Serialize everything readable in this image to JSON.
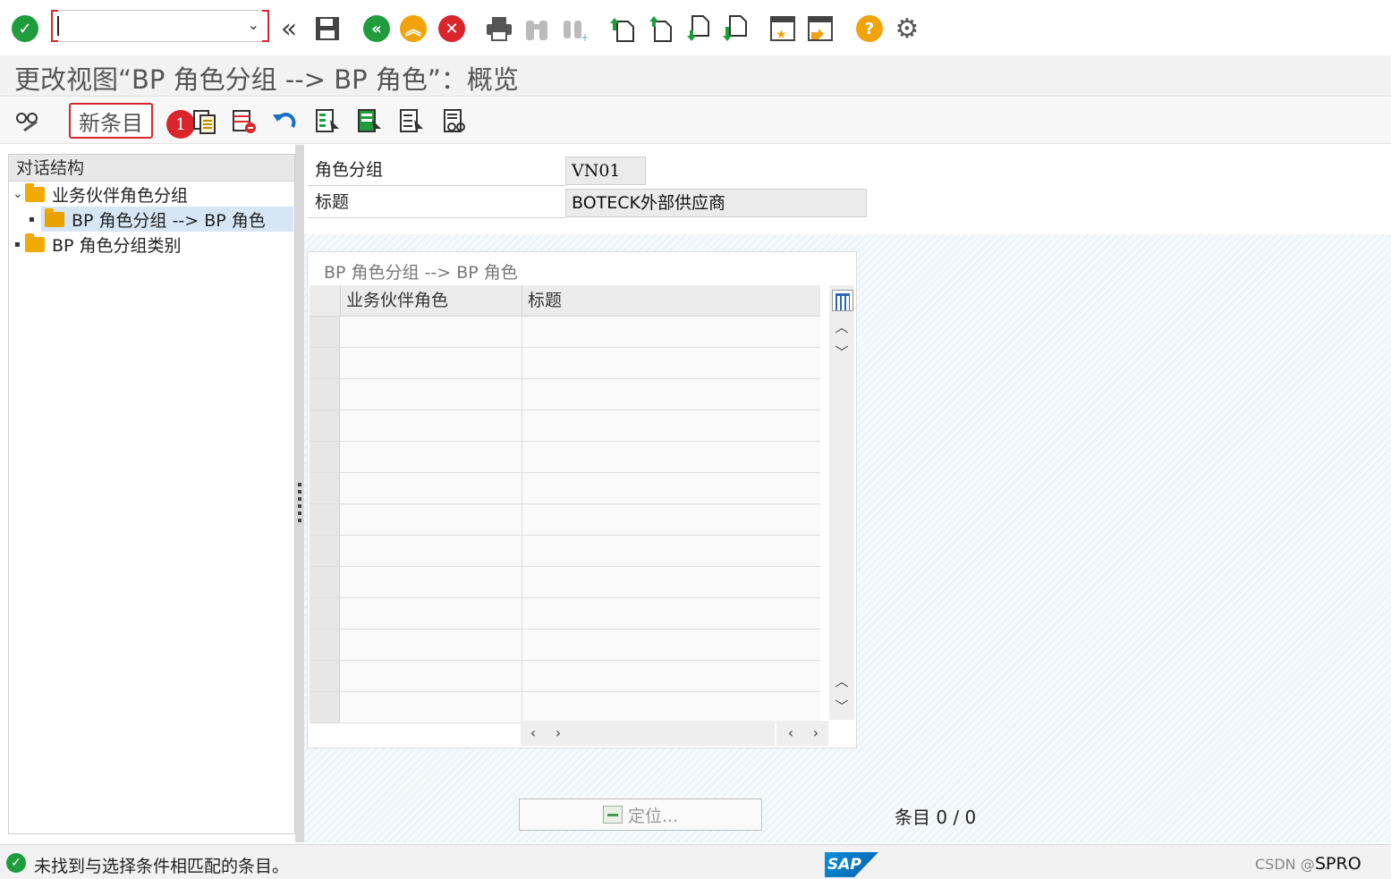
{
  "command_field": {
    "value": "",
    "placeholder": ""
  },
  "title": "更改视图“BP 角色分组 --> BP 角色”：概览",
  "toolbar": {
    "new_entries_label": "新条目",
    "marker_number": "1"
  },
  "tree": {
    "header": "对话结构",
    "items": [
      {
        "label": "业务伙伴角色分组",
        "level": 0,
        "expanded": true
      },
      {
        "label": "BP 角色分组 --> BP 角色",
        "level": 1,
        "selected": true
      },
      {
        "label": "BP 角色分组类别",
        "level": 0
      }
    ]
  },
  "fields": {
    "role_grouping_label": "角色分组",
    "role_grouping_value": "VN01",
    "title_label": "标题",
    "title_value": "BOTECK外部供应商"
  },
  "table": {
    "caption": "BP 角色分组 --> BP 角色",
    "columns": [
      "业务伙伴角色",
      "标题"
    ],
    "rows": []
  },
  "locate_button_label": "定位...",
  "entry_count": "条目 0 / 0",
  "status": {
    "message": "未找到与选择条件相匹配的条目。",
    "transaction": "SPRO",
    "watermark": "CSDN @..."
  },
  "colors": {
    "accent_red": "#d9262c",
    "ok_green": "#1f9d3d",
    "folder_orange": "#f2a900",
    "sap_blue": "#0a8fd6"
  }
}
